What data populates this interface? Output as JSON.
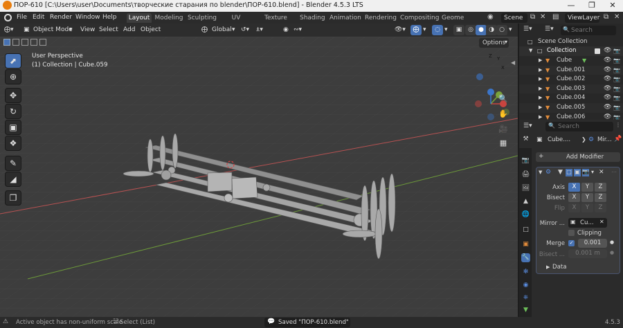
{
  "window": {
    "title": "ПОР-610 [C:\\Users\\user\\Documents\\творческие старания по blender\\ПОР-610.blend] - Blender 4.5.3 LTS"
  },
  "menubar": {
    "items": [
      "File",
      "Edit",
      "Render",
      "Window",
      "Help"
    ]
  },
  "workspaces": [
    "Layout",
    "Modeling",
    "Sculpting",
    "UV Editing",
    "Texture Paint",
    "Shading",
    "Animation",
    "Rendering",
    "Compositing",
    "Geome"
  ],
  "active_workspace": "Layout",
  "scene": {
    "name": "Scene"
  },
  "view_layer": {
    "name": "ViewLayer"
  },
  "viewport_header": {
    "mode": "Object Mode",
    "menus": [
      "View",
      "Select",
      "Add",
      "Object"
    ],
    "transform_orientation": "Global"
  },
  "viewport": {
    "perspective_label": "User Perspective",
    "context_label": "(1) Collection | Cube.059",
    "options_label": "Options",
    "gizmo_axes": {
      "x": "X",
      "y": "Y",
      "z": "Z"
    }
  },
  "outliner": {
    "search_placeholder": "Search",
    "root": "Scene Collection",
    "collection": "Collection",
    "objects": [
      "Cube",
      "Cube.001",
      "Cube.002",
      "Cube.003",
      "Cube.004",
      "Cube.005",
      "Cube.006"
    ]
  },
  "properties": {
    "search_placeholder": "Search",
    "breadcrumb_object": "Cube....",
    "breadcrumb_modifier": "Mir...",
    "add_modifier_label": "Add Modifier",
    "modifier": {
      "axis_label": "Axis",
      "bisect_label": "Bisect",
      "flip_label": "Flip",
      "axes": [
        "X",
        "Y",
        "Z"
      ],
      "axis_state": [
        true,
        false,
        false
      ],
      "bisect_state": [
        false,
        false,
        false
      ],
      "flip_state": [
        false,
        false,
        false
      ],
      "mirror_object_label": "Mirror ...",
      "mirror_object_value": "Cu...",
      "clipping_label": "Clipping",
      "clipping_checked": false,
      "merge_label": "Merge",
      "merge_checked": true,
      "merge_value": "0.001",
      "bisect_dist_label": "Bisect ...",
      "bisect_dist_value": "0.001 m",
      "data_label": "Data"
    }
  },
  "statusbar": {
    "left_message": "Active object has non-uniform scale",
    "select_hint": "Select (List)",
    "center_message": "Saved \"ПОР-610.blend\"",
    "version": "4.5.3"
  },
  "colors": {
    "accent": "#4772b3",
    "x_axis": "#c8443f",
    "y_axis": "#7aa33a",
    "z_axis": "#3b75c9",
    "viewport_bg": "#3d3d3d",
    "modifier_icon": "#5a8de0",
    "mesh_icon": "#e18b3b"
  }
}
